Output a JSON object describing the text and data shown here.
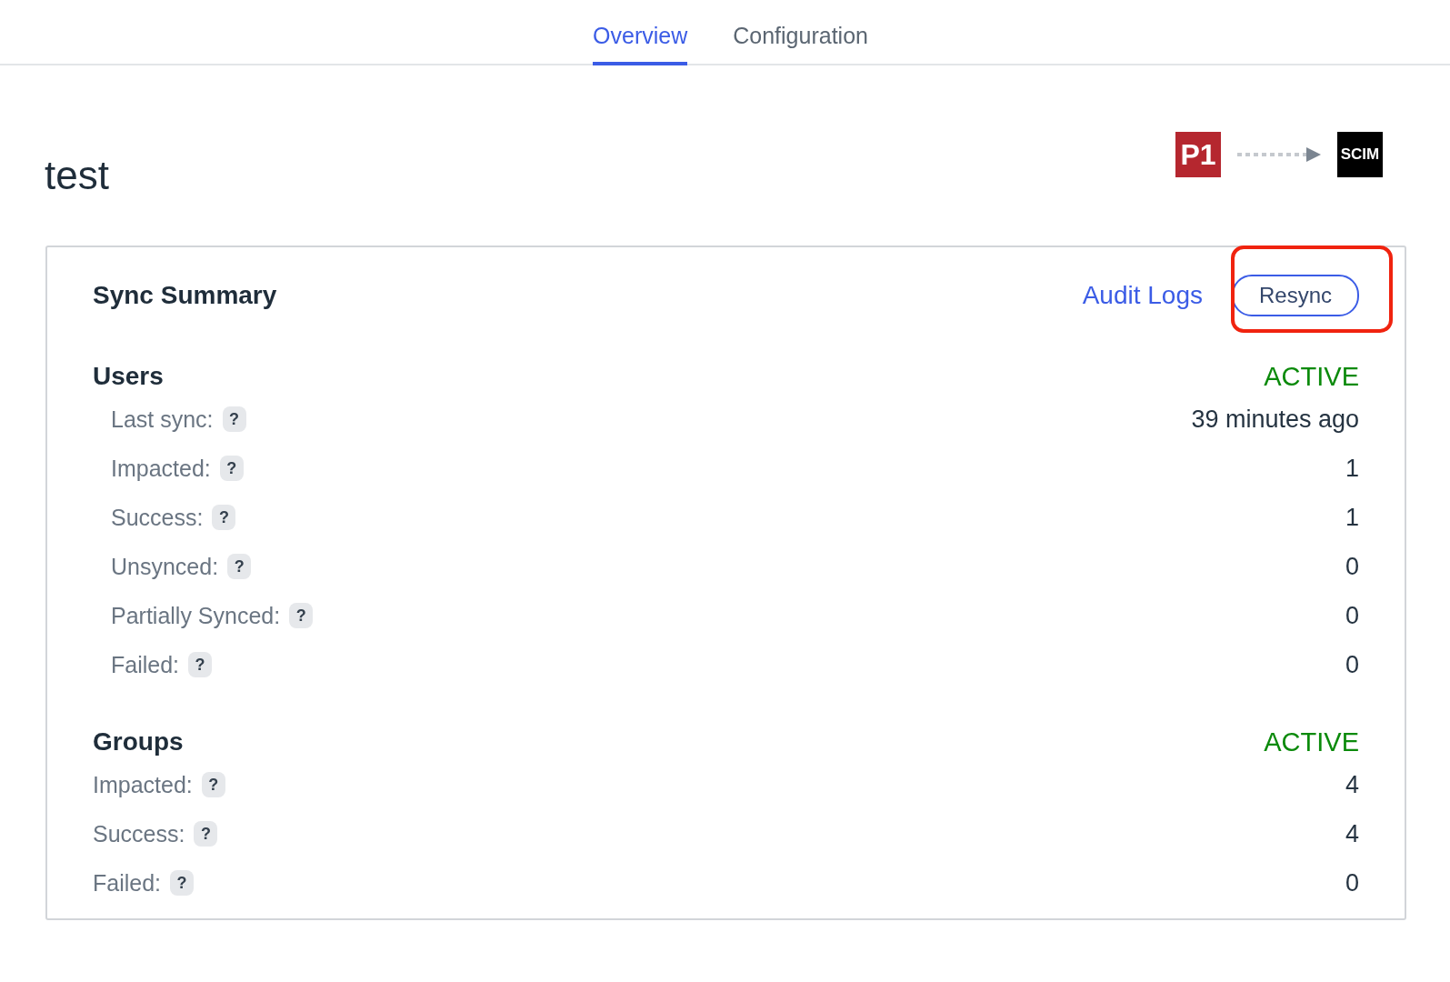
{
  "tabs": [
    {
      "label": "Overview",
      "selected": true
    },
    {
      "label": "Configuration",
      "selected": false
    }
  ],
  "title": "test",
  "flow": {
    "source": "P1",
    "target": "SCIM"
  },
  "summary": {
    "title": "Sync Summary",
    "link": "Audit Logs",
    "button": {
      "label": "Resync",
      "highlighted": true
    },
    "sections": [
      {
        "name": "Users",
        "status": "ACTIVE",
        "indented": true,
        "rows": [
          {
            "label": "Last sync:",
            "help": "?",
            "value": "39 minutes ago"
          },
          {
            "label": "Impacted:",
            "help": "?",
            "value": "1"
          },
          {
            "label": "Success:",
            "help": "?",
            "value": "1"
          },
          {
            "label": "Unsynced:",
            "help": "?",
            "value": "0"
          },
          {
            "label": "Partially Synced:",
            "help": "?",
            "value": "0"
          },
          {
            "label": "Failed:",
            "help": "?",
            "value": "0"
          }
        ]
      },
      {
        "name": "Groups",
        "status": "ACTIVE",
        "indented": false,
        "rows": [
          {
            "label": "Impacted:",
            "help": "?",
            "value": "4"
          },
          {
            "label": "Success:",
            "help": "?",
            "value": "4"
          },
          {
            "label": "Failed:",
            "help": "?",
            "value": "0"
          }
        ]
      }
    ]
  }
}
